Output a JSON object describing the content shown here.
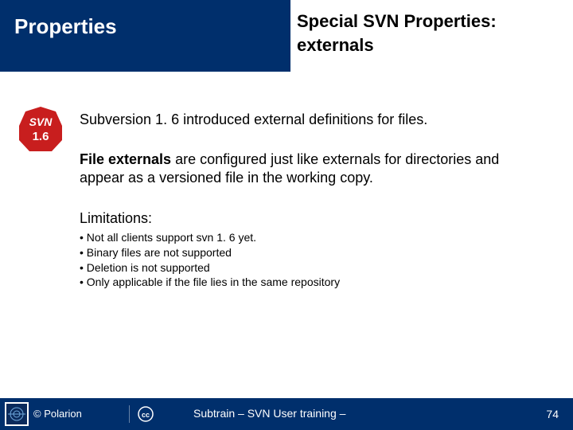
{
  "header": {
    "left": "Properties",
    "right_line1": "Special SVN Properties:",
    "right_line2": "externals"
  },
  "badge": {
    "top": "SVN",
    "bottom": "1.6"
  },
  "body": {
    "intro": "Subversion 1. 6 introduced external definitions for files.",
    "file_externals_label": "File externals",
    "file_externals_text": " are configured just like externals for directories and appear as a versioned file in the working copy.",
    "limitations_title": "Limitations:",
    "limitations": [
      "Not all clients support svn 1. 6 yet.",
      "Binary files are not supported",
      "Deletion is not supported",
      "Only applicable if the file lies in the same repository"
    ]
  },
  "footer": {
    "copyright": "© Polarion",
    "center": "Subtrain – SVN User training –",
    "page": "74"
  }
}
